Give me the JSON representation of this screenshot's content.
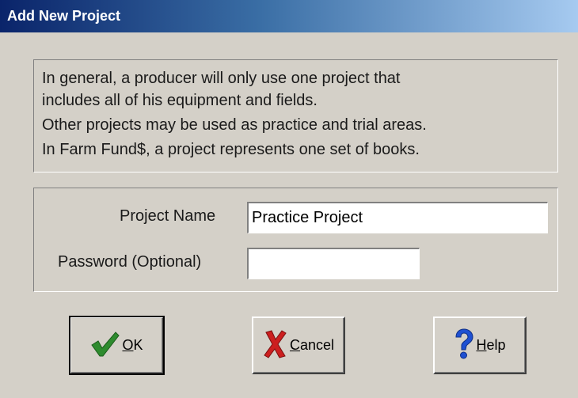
{
  "window": {
    "title": "Add New Project"
  },
  "info": {
    "lines": [
      "In general, a producer will only use one project that",
      "includes all of his equipment and fields.",
      "Other projects may be used as practice and trial areas.",
      "In Farm Fund$, a project represents one set of books."
    ]
  },
  "form": {
    "project_name_label": "Project Name",
    "project_name_value": "Practice Project",
    "password_label": "Password  (Optional)",
    "password_value": ""
  },
  "buttons": {
    "ok": {
      "first": "O",
      "rest": "K",
      "icon": "checkmark-icon",
      "icon_color": "#2e8b2e"
    },
    "cancel": {
      "first": "C",
      "rest": "ancel",
      "icon": "x-mark-icon",
      "icon_color": "#cc1f1f"
    },
    "help": {
      "first": "H",
      "rest": "elp",
      "icon": "question-mark-icon",
      "icon_color": "#1e50d2"
    }
  }
}
